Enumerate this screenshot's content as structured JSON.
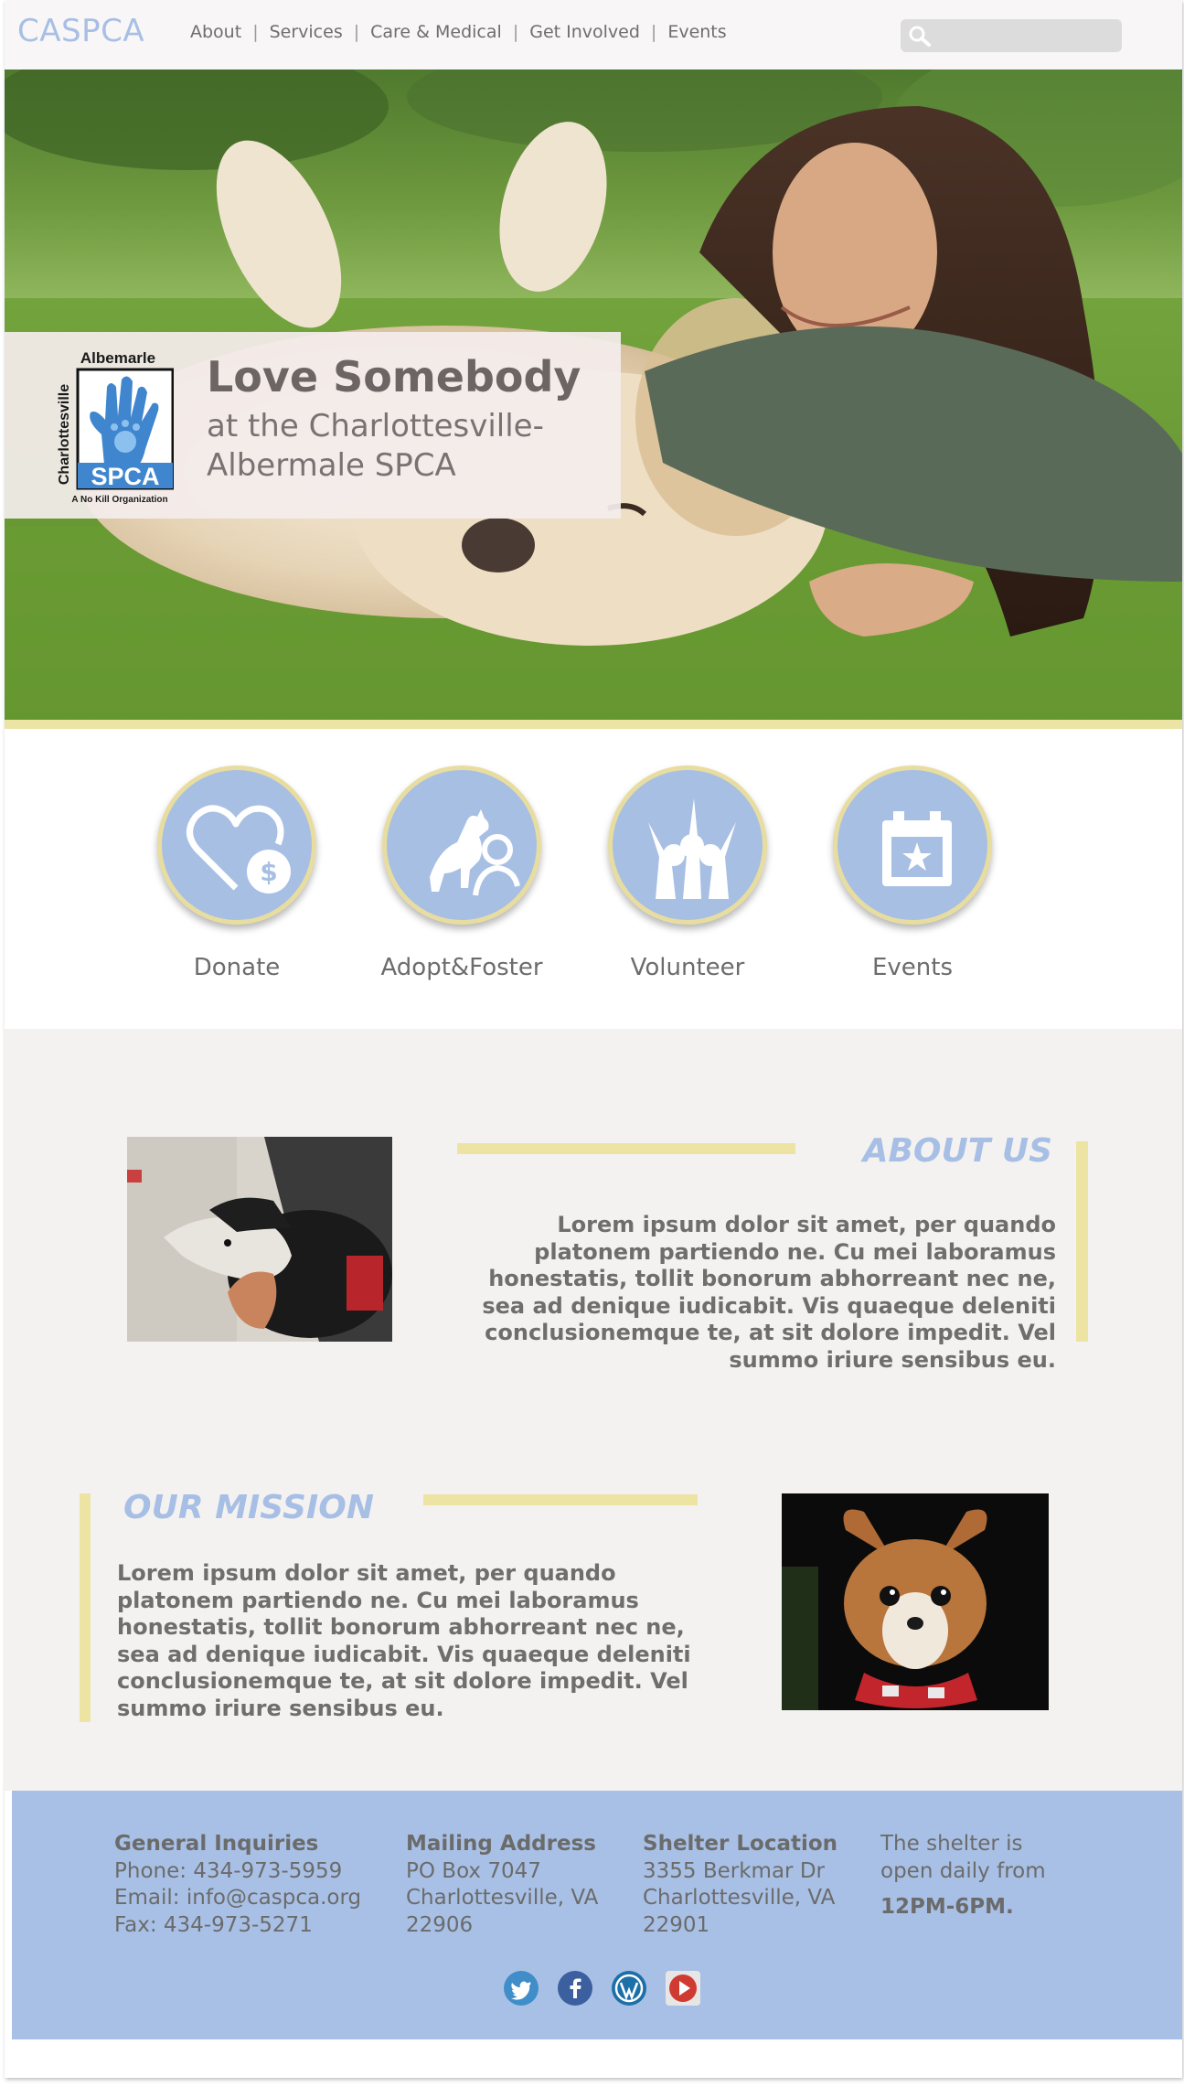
{
  "nav": {
    "brand": "CASPCA",
    "items": [
      {
        "label": "About"
      },
      {
        "label": "Services"
      },
      {
        "label": "Care & Medical"
      },
      {
        "label": "Get Involved"
      },
      {
        "label": "Events"
      }
    ],
    "search": {
      "value": "",
      "placeholder": ""
    }
  },
  "hero": {
    "logo": {
      "top_text": "Albemarle",
      "side_text": "Charlottesville",
      "mark": "SPCA",
      "tagline": "A No Kill Organization"
    },
    "title": "Love Somebody",
    "subtitle": "at the Charlottesville-Albermale SPCA"
  },
  "actions": [
    {
      "label": "Donate",
      "icon": "heart-dollar-icon"
    },
    {
      "label": "Adopt&Foster",
      "icon": "dog-person-icon"
    },
    {
      "label": "Volunteer",
      "icon": "people-hands-up-icon"
    },
    {
      "label": "Events",
      "icon": "calendar-star-icon"
    }
  ],
  "about": {
    "title": "ABOUT US",
    "body": "Lorem ipsum dolor sit amet, per quando platonem partiendo ne. Cu mei laboramus honestatis, tollit bonorum abhorreant nec ne, sea ad denique iudicabit. Vis quaeque deleniti conclusionemque te, at sit dolore impedit. Vel summo iriure sensibus eu."
  },
  "mission": {
    "title": "OUR MISSION",
    "body": "Lorem ipsum dolor sit amet, per quando platonem partiendo ne. Cu mei laboramus honestatis, tollit bonorum abhorreant nec ne, sea ad denique iudicabit. Vis quaeque deleniti conclusionemque te, at sit dolore impedit. Vel summo iriure sensibus eu."
  },
  "footer": {
    "general": {
      "heading": "General Inquiries",
      "phone": "Phone: 434-973-5959",
      "email": "Email: info@caspca.org",
      "fax": "Fax: 434-973-5271"
    },
    "mailing": {
      "heading": "Mailing Address",
      "line1": "PO Box 7047",
      "line2": "Charlottesville, VA",
      "line3": "22906"
    },
    "shelter": {
      "heading": "Shelter Location",
      "line1": "3355 Berkmar Dr",
      "line2": "Charlottesville, VA",
      "line3": "22901"
    },
    "hours": {
      "text1": "The shelter is",
      "text2": "open daily from",
      "time": "12PM-6PM."
    },
    "social": [
      "twitter-icon",
      "facebook-icon",
      "wordpress-icon",
      "youtube-icon"
    ]
  },
  "colors": {
    "accent_blue": "#a8bfe5",
    "accent_yellow": "#ede4a3",
    "text_gray": "#6b6b6b",
    "body_bg": "#f4f2f1"
  }
}
